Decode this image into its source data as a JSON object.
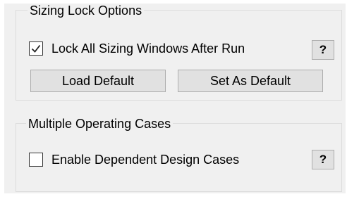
{
  "sizing_lock": {
    "title": "Sizing Lock Options",
    "lock_checkbox": {
      "label": "Lock All Sizing Windows After Run",
      "checked": true
    },
    "help_label": "?",
    "load_default_label": "Load Default",
    "set_default_label": "Set As Default"
  },
  "operating_cases": {
    "title": "Multiple Operating Cases",
    "enable_checkbox": {
      "label": "Enable Dependent Design Cases",
      "checked": false
    },
    "help_label": "?"
  },
  "icons": {
    "checkmark": "check-icon"
  }
}
